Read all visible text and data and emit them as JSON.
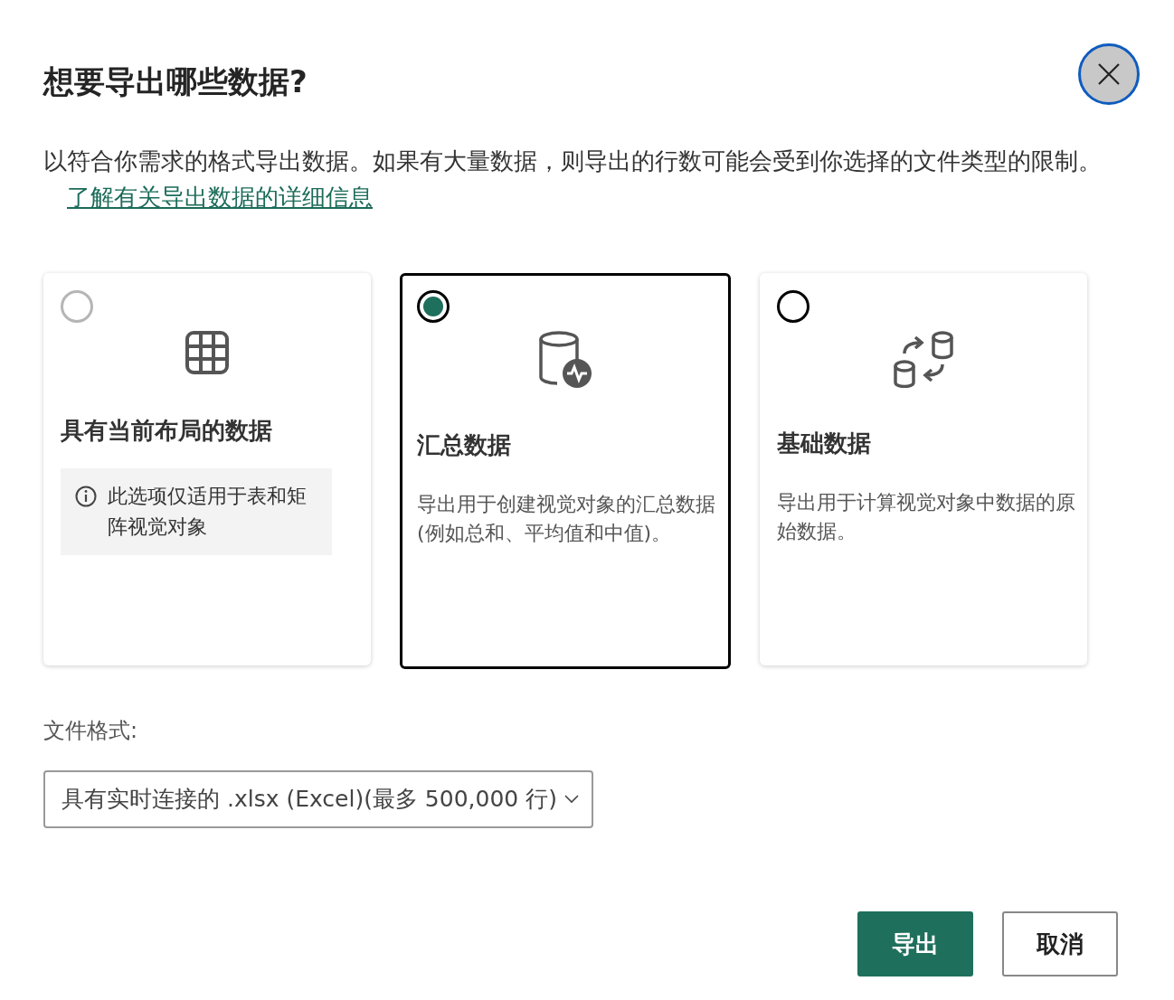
{
  "dialog": {
    "title": "想要导出哪些数据?",
    "description": "以符合你需求的格式导出数据。如果有大量数据，则导出的行数可能会受到你选择的文件类型的限制。",
    "learn_more_link": "了解有关导出数据的详细信息"
  },
  "options": [
    {
      "kind": "table",
      "title": "具有当前布局的数据",
      "selected": false,
      "disabled": true,
      "note": "此选项仅适用于表和矩阵视觉对象"
    },
    {
      "kind": "summary",
      "title": "汇总数据",
      "selected": true,
      "disabled": false,
      "description": "导出用于创建视觉对象的汇总数据(例如总和、平均值和中值)。"
    },
    {
      "kind": "underlying",
      "title": "基础数据",
      "selected": false,
      "disabled": false,
      "description": "导出用于计算视觉对象中数据的原始数据。"
    }
  ],
  "file_format": {
    "label": "文件格式:",
    "value": "具有实时连接的 .xlsx (Excel)(最多 500,000 行)"
  },
  "buttons": [
    {
      "kind": "primary",
      "label": "导出"
    },
    {
      "kind": "secondary",
      "label": "取消"
    }
  ]
}
